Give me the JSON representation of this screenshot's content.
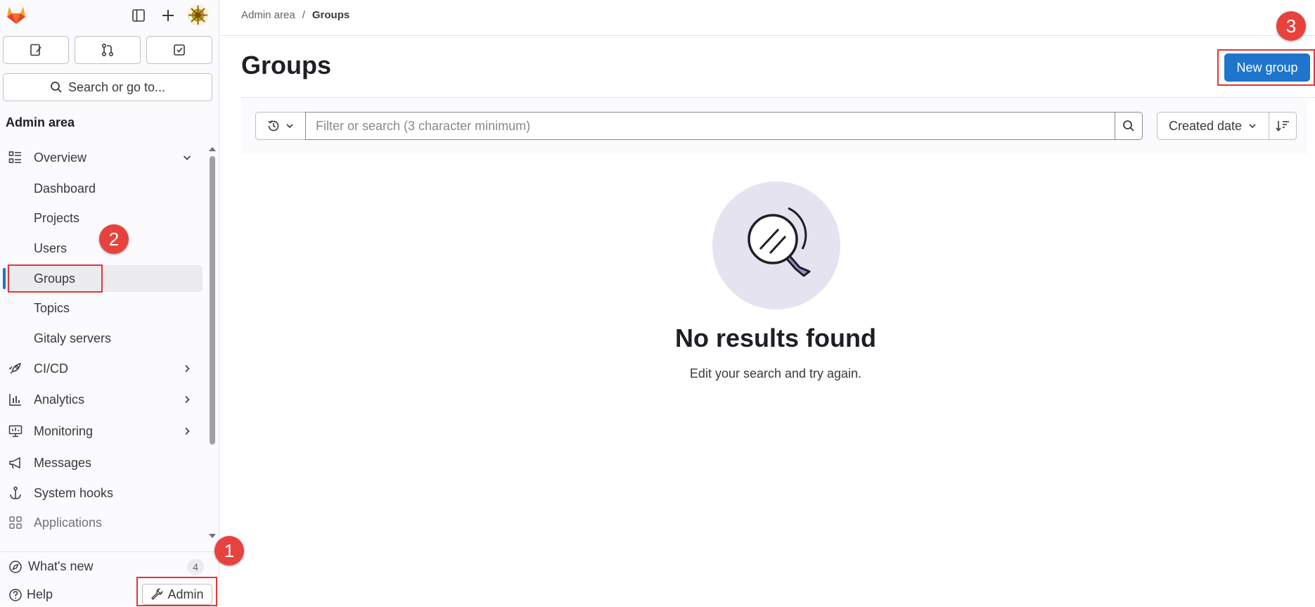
{
  "sidebar": {
    "search_label": "Search or go to...",
    "section_title": "Admin area",
    "items": [
      {
        "label": "Overview",
        "icon": "overview-icon",
        "expanded": true
      },
      {
        "label": "Dashboard"
      },
      {
        "label": "Projects"
      },
      {
        "label": "Users"
      },
      {
        "label": "Groups",
        "active": true
      },
      {
        "label": "Topics"
      },
      {
        "label": "Gitaly servers"
      },
      {
        "label": "CI/CD",
        "icon": "rocket-icon"
      },
      {
        "label": "Analytics",
        "icon": "chart-icon"
      },
      {
        "label": "Monitoring",
        "icon": "monitor-icon"
      },
      {
        "label": "Messages",
        "icon": "megaphone-icon"
      },
      {
        "label": "System hooks",
        "icon": "anchor-icon"
      },
      {
        "label": "Applications",
        "icon": "applications-icon"
      }
    ],
    "whats_new": {
      "label": "What's new",
      "count": "4"
    },
    "help_label": "Help",
    "admin_label": "Admin"
  },
  "breadcrumb": {
    "parent": "Admin area",
    "separator": "/",
    "current": "Groups"
  },
  "page": {
    "title": "Groups",
    "new_group_label": "New group"
  },
  "filter": {
    "placeholder": "Filter or search (3 character minimum)",
    "sort_label": "Created date"
  },
  "empty_state": {
    "title": "No results found",
    "description": "Edit your search and try again."
  },
  "annotations": {
    "step1": "1",
    "step2": "2",
    "step3": "3"
  },
  "colors": {
    "accent": "#1f75cb",
    "annotation": "#e0353a",
    "illustration_bg": "#e6e3f1"
  }
}
